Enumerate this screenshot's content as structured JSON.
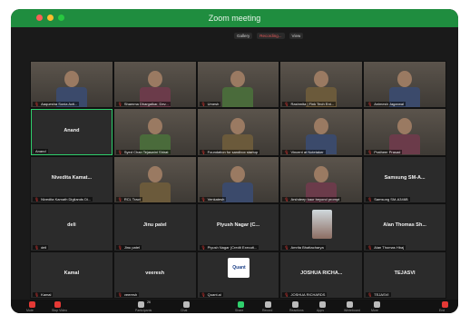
{
  "window": {
    "title": "Zoom meeting"
  },
  "status_bar": {
    "view_label": "Gallery",
    "recording_label": "Recording...",
    "grid_label": "View"
  },
  "tiles": [
    {
      "name": "Aaquesha Sonia Acti..."
    },
    {
      "name": "Shamma Dhargalkar, Dev..."
    },
    {
      "name": "Umesh"
    },
    {
      "name": "Rashmita | Fink Tech Ent..."
    },
    {
      "name": "Animesh Jagarwal"
    },
    {
      "name": "Anand"
    },
    {
      "name": "Syed Chan Tejaswini Shirat"
    },
    {
      "name": "Foundation for sandbox startup"
    },
    {
      "name": "Vincent at Notetaker"
    },
    {
      "name": "Pratheer Prasad"
    },
    {
      "name": "Nivedita Kamat...",
      "label": "Nivedita Kamath Digilands Di..."
    },
    {
      "name": "RCL Tract"
    },
    {
      "name": "Venkatesh"
    },
    {
      "name": "Arshdeep kaur beyond prompt"
    },
    {
      "name": "Samsung SM-A...",
      "label": "Samsung SM-A346B"
    },
    {
      "name": "deli"
    },
    {
      "name": "Jinu patel"
    },
    {
      "name": "Piyush Nagar (C...",
      "label": "Piyush Nagar (Credit Executi..."
    },
    {
      "name": "Amrita Bhattacharya"
    },
    {
      "name": "Alan Thomas Sh...",
      "label": "Alan Thomas Hbaj"
    },
    {
      "name": "Kamal"
    },
    {
      "name": "veeresh"
    },
    {
      "name": "Quant",
      "label": "Quant.ai"
    },
    {
      "name": "JOSHUA RICHA...",
      "label": "JOSHUA RICHARDS"
    },
    {
      "name": "TEJASVI"
    }
  ],
  "toolbar": {
    "items": [
      "Mute",
      "Stop Video",
      "Participants",
      "Chat",
      "Share",
      "Record",
      "Reactions",
      "Apps",
      "Whiteboard",
      "More",
      "End"
    ],
    "participant_count": "26"
  }
}
